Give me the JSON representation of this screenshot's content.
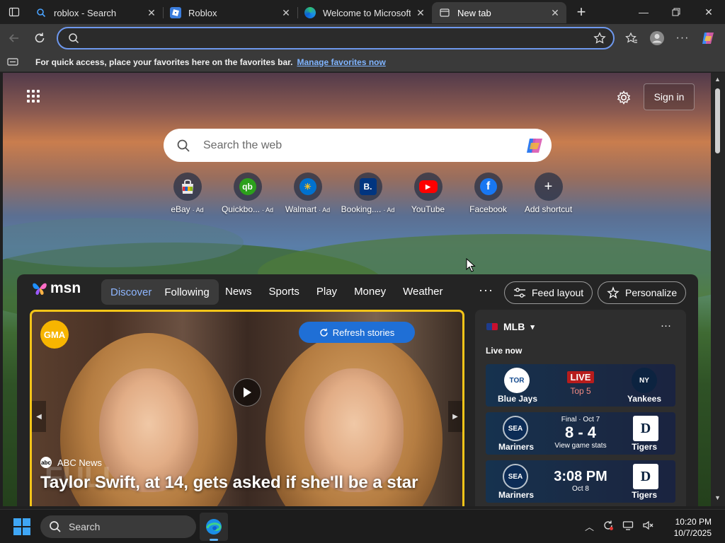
{
  "browser": {
    "tabs": [
      {
        "title": "roblox - Search",
        "icon": "search-icon",
        "active": false
      },
      {
        "title": "Roblox",
        "icon": "roblox-icon",
        "active": false
      },
      {
        "title": "Welcome to Microsoft E",
        "icon": "edge-icon",
        "active": false
      },
      {
        "title": "New tab",
        "icon": "newtab-icon",
        "active": true
      }
    ],
    "address": {
      "value": "",
      "placeholder": ""
    },
    "favorites_bar": {
      "text": "For quick access, place your favorites here on the favorites bar.",
      "link": "Manage favorites now"
    }
  },
  "newtab": {
    "signin_label": "Sign in",
    "search_placeholder": "Search the web",
    "shortcuts": [
      {
        "label": "eBay",
        "ad": "· Ad",
        "color": "#e53238",
        "glyph": "e"
      },
      {
        "label": "Quickbo...",
        "ad": "· Ad",
        "color": "#2ca01c",
        "glyph": "qb"
      },
      {
        "label": "Walmart",
        "ad": "· Ad",
        "color": "#0071ce",
        "glyph": "✳"
      },
      {
        "label": "Booking....",
        "ad": "· Ad",
        "color": "#003580",
        "glyph": "B."
      },
      {
        "label": "YouTube",
        "ad": "",
        "color": "#ff0000",
        "glyph": "▶"
      },
      {
        "label": "Facebook",
        "ad": "",
        "color": "#1877f2",
        "glyph": "f"
      },
      {
        "label": "Add shortcut",
        "ad": "",
        "color": "#5a5a5a",
        "glyph": "+"
      }
    ]
  },
  "msn": {
    "brand": "msn",
    "toggle": {
      "discover": "Discover",
      "following": "Following"
    },
    "nav": [
      "News",
      "Sports",
      "Play",
      "Money",
      "Weather"
    ],
    "more": "···",
    "feed_layout": "Feed layout",
    "personalize": "Personalize",
    "hero": {
      "badge": "GMA",
      "refresh": "Refresh stories",
      "source": "ABC News",
      "title": "Taylor Swift, at 14, gets asked if she'll be a star",
      "watermark": "FULL"
    },
    "mlb": {
      "title": "MLB",
      "more": "···",
      "live_now": "Live now",
      "games": [
        {
          "away": "Blue Jays",
          "home": "Yankees",
          "status": "LIVE",
          "detail": "Top 5"
        },
        {
          "away": "Mariners",
          "home": "Tigers",
          "status": "Final · Oct 7",
          "score": "8 - 4",
          "detail": "View game stats"
        },
        {
          "away": "Mariners",
          "home": "Tigers",
          "status": "3:08 PM",
          "detail": "Oct 8"
        }
      ]
    }
  },
  "taskbar": {
    "search_label": "Search",
    "time": "10:20 PM",
    "date": "10/7/2025"
  },
  "colors": {
    "accent": "#6e98ee",
    "hero_border": "#f5c518",
    "refresh": "#1f6fd6",
    "live": "#b71c1c"
  }
}
